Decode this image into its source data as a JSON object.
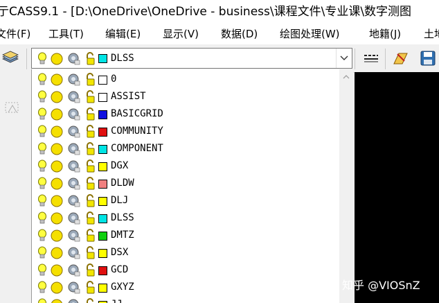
{
  "window": {
    "title": "亍CASS9.1 - [D:\\OneDrive\\OneDrive - business\\课程文件\\专业课\\数字测图"
  },
  "menu": [
    {
      "label": "文件(F)"
    },
    {
      "label": "工具(T)"
    },
    {
      "label": "编辑(E)"
    },
    {
      "label": "显示(V)"
    },
    {
      "label": "数据(D)"
    },
    {
      "label": "绘图处理(W)"
    },
    {
      "label": "地籍(J)"
    },
    {
      "label": "土地"
    }
  ],
  "layer_combo": {
    "selected": {
      "name": "DLSS",
      "color": "#00e5e5"
    }
  },
  "layers": [
    {
      "name": "0",
      "color": "#ffffff"
    },
    {
      "name": "ASSIST",
      "color": "#ffffff"
    },
    {
      "name": "BASICGRID",
      "color": "#1010e0"
    },
    {
      "name": "COMMUNITY",
      "color": "#e01010"
    },
    {
      "name": "COMPONENT",
      "color": "#00e5e5"
    },
    {
      "name": "DGX",
      "color": "#ffff00"
    },
    {
      "name": "DLDW",
      "color": "#f08080"
    },
    {
      "name": "DLJ",
      "color": "#ffff00"
    },
    {
      "name": "DLSS",
      "color": "#00e5e5"
    },
    {
      "name": "DMTZ",
      "color": "#10d010"
    },
    {
      "name": "DSX",
      "color": "#ffff00"
    },
    {
      "name": "GCD",
      "color": "#e01010"
    },
    {
      "name": "GXYZ",
      "color": "#ffff00"
    },
    {
      "name": "JJ",
      "color": "#ffff00"
    }
  ],
  "watermark": "知乎 @VIOSnZ"
}
